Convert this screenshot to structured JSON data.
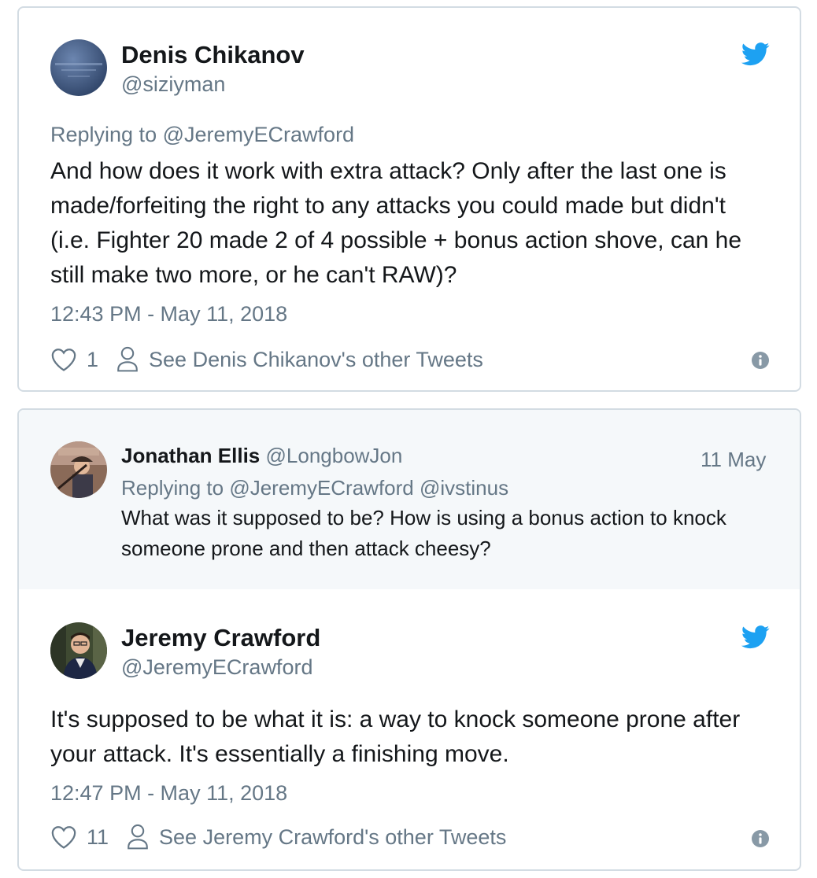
{
  "tweet1": {
    "display_name": "Denis Chikanov",
    "handle": "@siziyman",
    "replying_prefix": "Replying to",
    "replying_to": "@JeremyECrawford",
    "text": "And how does it work with extra attack? Only after the last one is made/forfeiting the right to any attacks you could made but didn't (i.e. Fighter 20 made 2 of 4 possible + bonus action shove, can he still make two more, or he can't RAW)?",
    "timestamp": "12:43 PM - May 11, 2018",
    "likes": "1",
    "other_tweets_link": "See Denis Chikanov's other Tweets",
    "avatar_icon": "avatar-photo",
    "brand_icon": "twitter-bird-icon"
  },
  "quoted": {
    "display_name": "Jonathan Ellis",
    "handle": "@LongbowJon",
    "date": "11 May",
    "replying_prefix": "Replying to",
    "replying_to": "@JeremyECrawford @ivstinus",
    "text": "What was it supposed to be? How is using a bonus action to knock someone prone and then attack cheesy?"
  },
  "tweet2": {
    "display_name": "Jeremy Crawford",
    "handle": "@JeremyECrawford",
    "text": "It's supposed to be what it is: a way to knock someone prone after your attack. It's essentially a finishing move.",
    "timestamp": "12:47 PM - May 11, 2018",
    "likes": "11",
    "other_tweets_link": "See Jeremy Crawford's other Tweets"
  },
  "colors": {
    "twitter_blue": "#1da1f2",
    "muted_text": "#657786",
    "border": "#d3dce3",
    "quote_bg": "#f5f8fa"
  }
}
